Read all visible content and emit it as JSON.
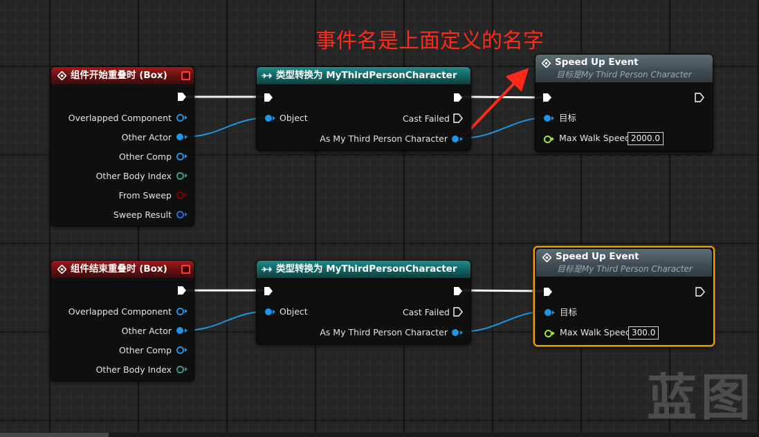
{
  "annotation": "事件名是上面定义的名字",
  "watermark": "蓝图",
  "colors": {
    "event_header": "#a31818",
    "cast_header": "#1f8a8a",
    "call_header": "#5d6d74",
    "object_pin": "#1b96e8",
    "float_pin": "#9ee83b",
    "struct_pin": "#2fa08a",
    "bool_pin": "#8a0000",
    "selection": "#f0a300",
    "annotation": "#ff2a1a"
  },
  "graph_rows": [
    {
      "event_node": {
        "title": "组件开始重叠时 (Box)",
        "icon": "event-diamond-icon",
        "pins": [
          "Overlapped Component",
          "Other Actor",
          "Other Comp",
          "Other Body Index",
          "From Sweep",
          "Sweep Result"
        ]
      },
      "cast_node": {
        "title": "类型转换为 MyThirdPersonCharacter",
        "icon": "cast-arrows-icon",
        "object_pin": "Object",
        "cast_failed_pin": "Cast Failed",
        "as_pin": "As My Third Person Character"
      },
      "call_node": {
        "title": "Speed Up Event",
        "subtitle": "目标是My Third Person Character",
        "icon": "function-diamond-icon",
        "target_pin": "目标",
        "speed_pin": "Max Walk Speed",
        "speed_value": "2000.0",
        "selected": false
      }
    },
    {
      "event_node": {
        "title": "组件结束重叠时 (Box)",
        "icon": "event-diamond-icon",
        "pins": [
          "Overlapped Component",
          "Other Actor",
          "Other Comp",
          "Other Body Index"
        ]
      },
      "cast_node": {
        "title": "类型转换为 MyThirdPersonCharacter",
        "icon": "cast-arrows-icon",
        "object_pin": "Object",
        "cast_failed_pin": "Cast Failed",
        "as_pin": "As My Third Person Character"
      },
      "call_node": {
        "title": "Speed Up Event",
        "subtitle": "目标是My Third Person Character",
        "icon": "function-diamond-icon",
        "target_pin": "目标",
        "speed_pin": "Max Walk Speed",
        "speed_value": "300.0",
        "selected": true
      }
    }
  ]
}
